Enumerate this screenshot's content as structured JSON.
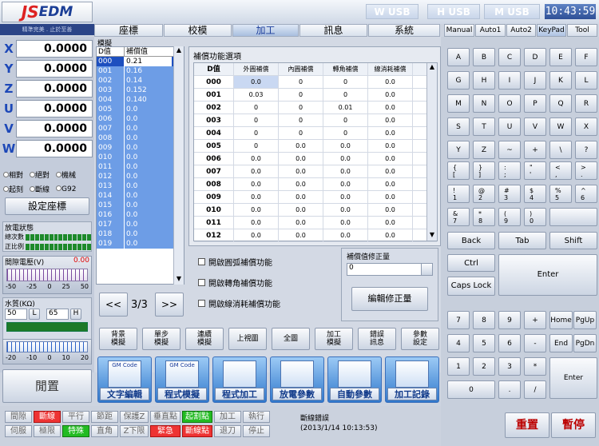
{
  "header": {
    "logo_prefix": "JS",
    "logo_suffix": "EDM",
    "slogan": "精準完美 . 止於至善",
    "usb": [
      "W USB",
      "H USB",
      "M USB"
    ],
    "clock": "10:43:59"
  },
  "tabs": [
    "座標",
    "校模",
    "加工",
    "訊息",
    "系統"
  ],
  "active_tab": "加工",
  "axes": [
    {
      "name": "X",
      "value": "0.0000"
    },
    {
      "name": "Y",
      "value": "0.0000"
    },
    {
      "name": "Z",
      "value": "0.0000"
    },
    {
      "name": "U",
      "value": "0.0000"
    },
    {
      "name": "V",
      "value": "0.0000"
    },
    {
      "name": "W",
      "value": "0.0000"
    }
  ],
  "coord_modes_row1": [
    "相對",
    "絕對",
    "機械"
  ],
  "coord_modes_row2": [
    "起刻",
    "斷線",
    "G92"
  ],
  "set_coord_label": "設定座標",
  "discharge": {
    "title": "放電狀態",
    "line1": "總次數",
    "line2": "正比例"
  },
  "gap_voltage": {
    "title": "間隙電壓(V)",
    "value": "0.00",
    "scale": [
      "-50",
      "-25",
      "0",
      "25",
      "50"
    ]
  },
  "water": {
    "title": "水質(KΩ)",
    "val1": "50",
    "btn1": "L",
    "val2": "65",
    "btn2": "H",
    "scale": [
      "-20",
      "-10",
      "0",
      "10",
      "20"
    ]
  },
  "close_label": "閒置",
  "dlist": {
    "title": "模擬",
    "col1": "D值",
    "col2": "補償值",
    "rows": [
      [
        "000",
        "0.21"
      ],
      [
        "001",
        "0.16"
      ],
      [
        "002",
        "0.14"
      ],
      [
        "003",
        "0.152"
      ],
      [
        "004",
        "0.140"
      ],
      [
        "005",
        "0.0"
      ],
      [
        "006",
        "0.0"
      ],
      [
        "007",
        "0.0"
      ],
      [
        "008",
        "0.0"
      ],
      [
        "009",
        "0.0"
      ],
      [
        "010",
        "0.0"
      ],
      [
        "011",
        "0.0"
      ],
      [
        "012",
        "0.0"
      ],
      [
        "013",
        "0.0"
      ],
      [
        "014",
        "0.0"
      ],
      [
        "015",
        "0.0"
      ],
      [
        "016",
        "0.0"
      ],
      [
        "017",
        "0.0"
      ],
      [
        "018",
        "0.0"
      ],
      [
        "019",
        "0.0"
      ]
    ]
  },
  "pager": {
    "prev": "<<",
    "page": "3/3",
    "next": ">>"
  },
  "comp": {
    "title": "補償功能選項",
    "headers": [
      "D值",
      "外圓補償",
      "內圓補償",
      "轉角補償",
      "線消耗補償"
    ],
    "rows": [
      [
        "000",
        "0.0",
        "0",
        "0",
        "0.0"
      ],
      [
        "001",
        "0.03",
        "0",
        "0",
        "0.0"
      ],
      [
        "002",
        "0",
        "0",
        "0.01",
        "0.0"
      ],
      [
        "003",
        "0",
        "0",
        "0",
        "0.0"
      ],
      [
        "004",
        "0",
        "0",
        "0",
        "0.0"
      ],
      [
        "005",
        "0",
        "0.0",
        "0.0",
        "0.0"
      ],
      [
        "006",
        "0.0",
        "0.0",
        "0.0",
        "0.0"
      ],
      [
        "007",
        "0.0",
        "0.0",
        "0.0",
        "0.0"
      ],
      [
        "008",
        "0.0",
        "0.0",
        "0.0",
        "0.0"
      ],
      [
        "009",
        "0.0",
        "0.0",
        "0.0",
        "0.0"
      ],
      [
        "010",
        "0.0",
        "0.0",
        "0.0",
        "0.0"
      ],
      [
        "011",
        "0.0",
        "0.0",
        "0.0",
        "0.0"
      ],
      [
        "012",
        "0.0",
        "0.0",
        "0.0",
        "0.0"
      ]
    ]
  },
  "checks": [
    "開啟圓弧補償功能",
    "開啟轉角補償功能",
    "開啟線消耗補償功能"
  ],
  "correction": {
    "title": "補償值修正量",
    "value": "0",
    "button": "編輯修正量"
  },
  "toolbar": [
    [
      "背景",
      "模擬"
    ],
    [
      "單步",
      "模擬"
    ],
    [
      "連續",
      "模擬"
    ],
    [
      "上視圖",
      ""
    ],
    [
      "全圖",
      ""
    ],
    [
      "加工",
      "模擬"
    ],
    [
      "錯誤",
      "訊息"
    ],
    [
      "參數",
      "設定"
    ]
  ],
  "big_buttons": [
    {
      "label": "文字編輯",
      "icon": "GM Code"
    },
    {
      "label": "程式模擬",
      "icon": "GM Code"
    },
    {
      "label": "程式加工",
      "icon": ""
    },
    {
      "label": "放電參數",
      "icon": ""
    },
    {
      "label": "自動參數",
      "icon": ""
    },
    {
      "label": "加工記錄",
      "icon": ""
    }
  ],
  "kb_tabs": [
    "Manual",
    "Auto1",
    "Auto2",
    "KeyPad",
    "Tool"
  ],
  "kb_active": "KeyPad",
  "letters": [
    "A",
    "B",
    "C",
    "D",
    "E",
    "F",
    "G",
    "H",
    "I",
    "J",
    "K",
    "L",
    "M",
    "N",
    "O",
    "P",
    "Q",
    "R",
    "S",
    "T",
    "U",
    "V",
    "W",
    "X",
    "Y",
    "Z",
    "~",
    "+",
    "\\",
    "?"
  ],
  "sym_rows": [
    [
      "{",
      "}",
      ":",
      "\"",
      "<",
      ">"
    ],
    [
      "!",
      "@",
      "#",
      "$",
      "%",
      "^"
    ],
    [
      "&",
      "*",
      "(",
      ")",
      "",
      ""
    ]
  ],
  "sym_lower": [
    [
      "[",
      "]",
      ";",
      "'",
      ",",
      "."
    ],
    [
      "1",
      "2",
      "3",
      "4",
      "5",
      "6"
    ],
    [
      "7",
      "8",
      "9",
      "0",
      "",
      ""
    ]
  ],
  "ctrl": {
    "back": "Back",
    "tab": "Tab",
    "shift": "Shift",
    "ctrl": "Ctrl",
    "enter": "Enter",
    "caps": "Caps Lock"
  },
  "numpad": [
    [
      "7",
      "8",
      "9",
      "+",
      "Home",
      "PgUp"
    ],
    [
      "4",
      "5",
      "6",
      "-",
      "End",
      "PgDn"
    ],
    [
      "1",
      "2",
      "3",
      "*",
      "",
      ""
    ]
  ],
  "numpad_last": {
    "zero": "0",
    "dot": ".",
    "slash": "/",
    "enter": "Enter"
  },
  "status_row1": [
    {
      "t": "間隙",
      "c": ""
    },
    {
      "t": "斷線",
      "c": "red"
    },
    {
      "t": "平行",
      "c": ""
    },
    {
      "t": "節距",
      "c": ""
    },
    {
      "t": "保護Z",
      "c": ""
    },
    {
      "t": "垂直點",
      "c": ""
    },
    {
      "t": "起割點",
      "c": "green"
    },
    {
      "t": "加工",
      "c": ""
    },
    {
      "t": "執行",
      "c": ""
    }
  ],
  "status_row2": [
    {
      "t": "伺服",
      "c": ""
    },
    {
      "t": "極限",
      "c": ""
    },
    {
      "t": "特殊",
      "c": "green"
    },
    {
      "t": "直角",
      "c": ""
    },
    {
      "t": "Z下限",
      "c": ""
    },
    {
      "t": "緊急",
      "c": "red"
    },
    {
      "t": "斷線點",
      "c": "red"
    },
    {
      "t": "退刀",
      "c": ""
    },
    {
      "t": "停止",
      "c": ""
    }
  ],
  "message": {
    "line1": "斷線錯誤",
    "line2": "(2013/1/14  10:13:53)"
  },
  "reset_label": "重置",
  "pause_label": "暫停"
}
